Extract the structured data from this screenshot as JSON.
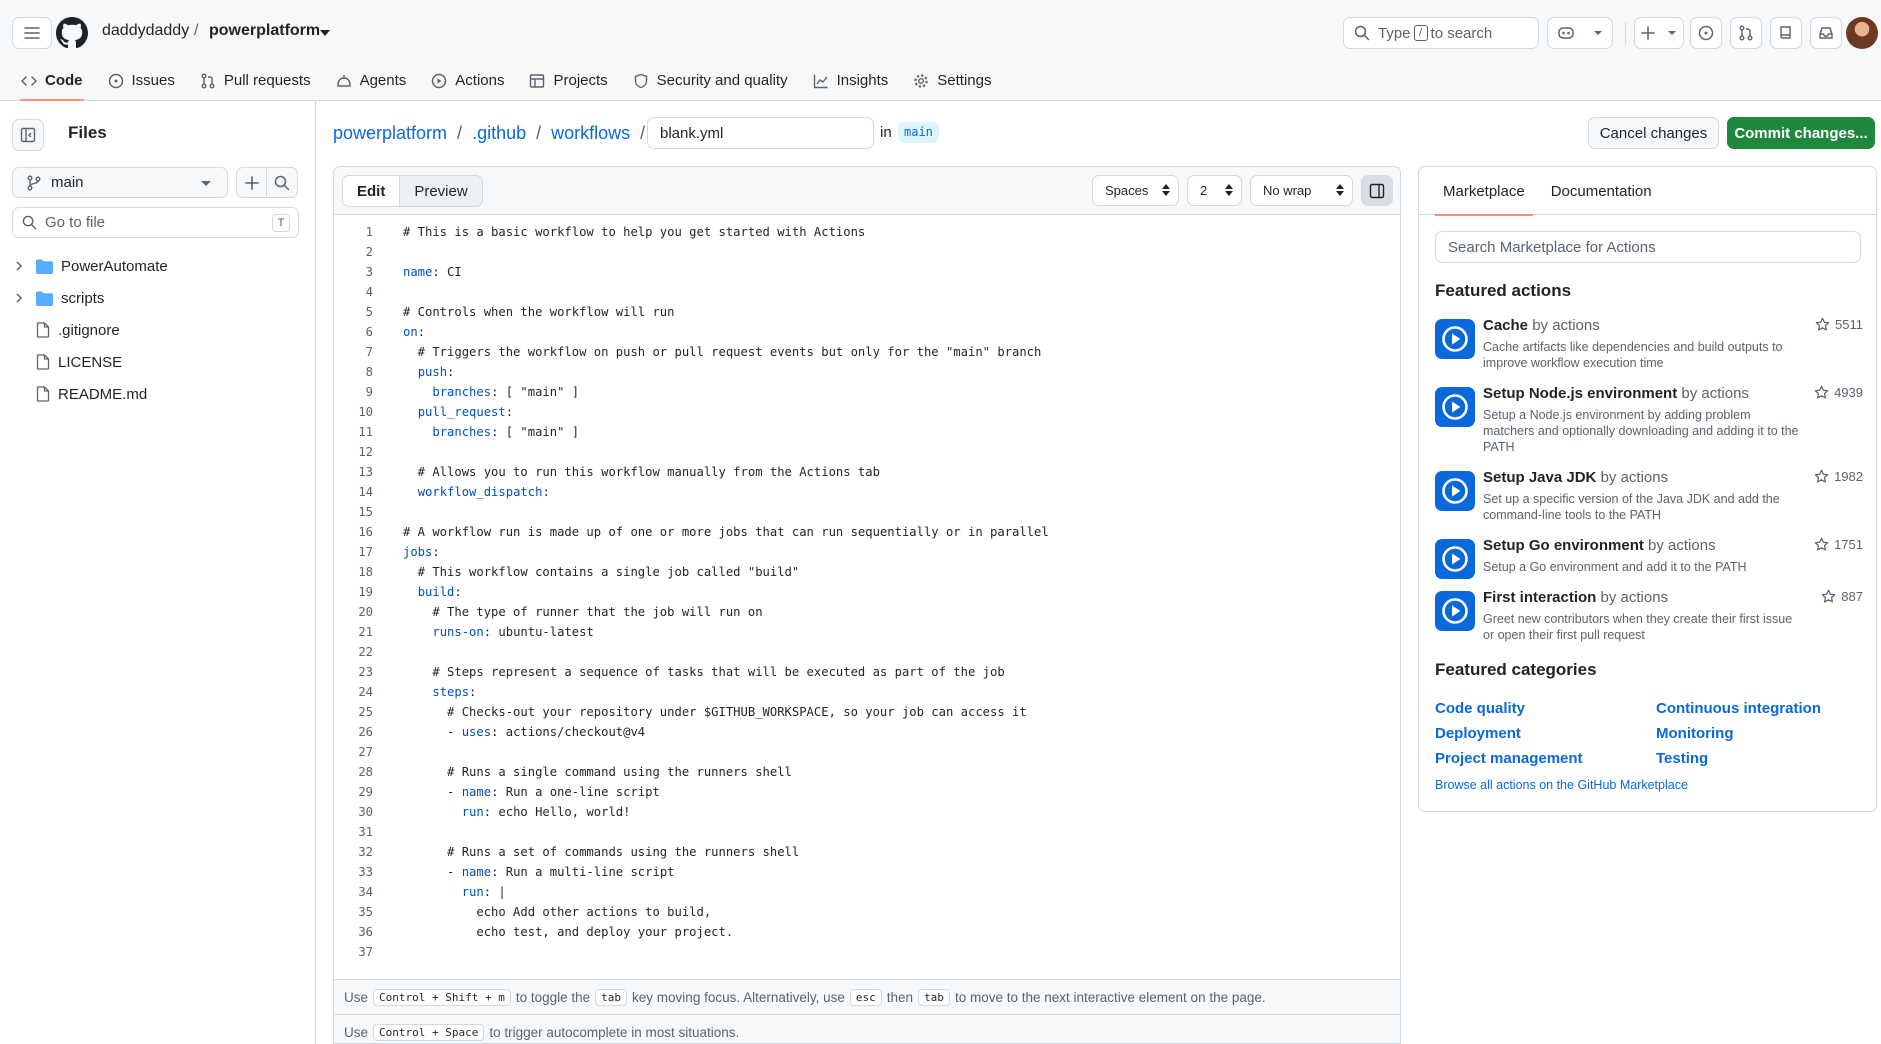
{
  "header": {
    "owner": "daddydaddy",
    "slash": "/",
    "repo": "powerplatform",
    "search_placeholder_prefix": "Type",
    "search_kbd": "/",
    "search_placeholder_suffix": "to search"
  },
  "nav": {
    "items": [
      {
        "label": "Code",
        "icon": "code-icon",
        "selected": true
      },
      {
        "label": "Issues",
        "icon": "issue-icon"
      },
      {
        "label": "Pull requests",
        "icon": "pull-request-icon"
      },
      {
        "label": "Agents",
        "icon": "agents-icon"
      },
      {
        "label": "Actions",
        "icon": "play-icon"
      },
      {
        "label": "Projects",
        "icon": "table-icon"
      },
      {
        "label": "Security and quality",
        "icon": "shield-icon"
      },
      {
        "label": "Insights",
        "icon": "graph-icon"
      },
      {
        "label": "Settings",
        "icon": "gear-icon"
      }
    ]
  },
  "sidebar": {
    "title": "Files",
    "branch": "main",
    "goto_placeholder": "Go to file",
    "goto_kbd": "T",
    "tree": [
      {
        "name": "PowerAutomate",
        "type": "folder"
      },
      {
        "name": "scripts",
        "type": "folder"
      },
      {
        "name": ".gitignore",
        "type": "file"
      },
      {
        "name": "LICENSE",
        "type": "file"
      },
      {
        "name": "README.md",
        "type": "file"
      }
    ]
  },
  "path": {
    "segments": [
      "powerplatform",
      ".github",
      "workflows"
    ],
    "filename": "blank.yml",
    "in_label": "in",
    "branch": "main"
  },
  "buttons": {
    "cancel": "Cancel changes",
    "commit": "Commit changes..."
  },
  "editor": {
    "tab_edit": "Edit",
    "tab_preview": "Preview",
    "indent_mode": "Spaces",
    "indent_size": "2",
    "wrap_mode": "No wrap",
    "lines": [
      "# This is a basic workflow to help you get started with Actions",
      "",
      "name: CI",
      "",
      "# Controls when the workflow will run",
      "on:",
      "  # Triggers the workflow on push or pull request events but only for the \"main\" branch",
      "  push:",
      "    branches: [ \"main\" ]",
      "  pull_request:",
      "    branches: [ \"main\" ]",
      "",
      "  # Allows you to run this workflow manually from the Actions tab",
      "  workflow_dispatch:",
      "",
      "# A workflow run is made up of one or more jobs that can run sequentially or in parallel",
      "jobs:",
      "  # This workflow contains a single job called \"build\"",
      "  build:",
      "    # The type of runner that the job will run on",
      "    runs-on: ubuntu-latest",
      "",
      "    # Steps represent a sequence of tasks that will be executed as part of the job",
      "    steps:",
      "      # Checks-out your repository under $GITHUB_WORKSPACE, so your job can access it",
      "      - uses: actions/checkout@v4",
      "",
      "      # Runs a single command using the runners shell",
      "      - name: Run a one-line script",
      "        run: echo Hello, world!",
      "",
      "      # Runs a set of commands using the runners shell",
      "      - name: Run a multi-line script",
      "        run: |",
      "          echo Add other actions to build,",
      "          echo test, and deploy your project.",
      ""
    ],
    "hint1": {
      "use": "Use",
      "kbd1": "Control + Shift + m",
      "mid1": "to toggle the",
      "kbd2": "tab",
      "mid2": "key moving focus. Alternatively, use",
      "kbd3": "esc",
      "mid3": "then",
      "kbd4": "tab",
      "end": "to move to the next interactive element on the page."
    },
    "hint2": {
      "use": "Use",
      "kbd1": "Control + Space",
      "end": "to trigger autocomplete in most situations."
    }
  },
  "marketplace": {
    "tab_marketplace": "Marketplace",
    "tab_docs": "Documentation",
    "search_placeholder": "Search Marketplace for Actions",
    "featured_actions_title": "Featured actions",
    "actions": [
      {
        "name": "Cache",
        "by": "by actions",
        "desc": "Cache artifacts like dependencies and build outputs to improve workflow execution time",
        "stars": "5511"
      },
      {
        "name": "Setup Node.js environment",
        "by": "by actions",
        "desc": "Setup a Node.js environment by adding problem matchers and optionally downloading and adding it to the PATH",
        "stars": "4939"
      },
      {
        "name": "Setup Java JDK",
        "by": "by actions",
        "desc": "Set up a specific version of the Java JDK and add the command-line tools to the PATH",
        "stars": "1982"
      },
      {
        "name": "Setup Go environment",
        "by": "by actions",
        "desc": "Setup a Go environment and add it to the PATH",
        "stars": "1751"
      },
      {
        "name": "First interaction",
        "by": "by actions",
        "desc": "Greet new contributors when they create their first issue or open their first pull request",
        "stars": "887"
      }
    ],
    "featured_categories_title": "Featured categories",
    "categories": [
      "Code quality",
      "Continuous integration",
      "Deployment",
      "Monitoring",
      "Project management",
      "Testing"
    ],
    "browse_link": "Browse all actions on the GitHub Marketplace"
  }
}
